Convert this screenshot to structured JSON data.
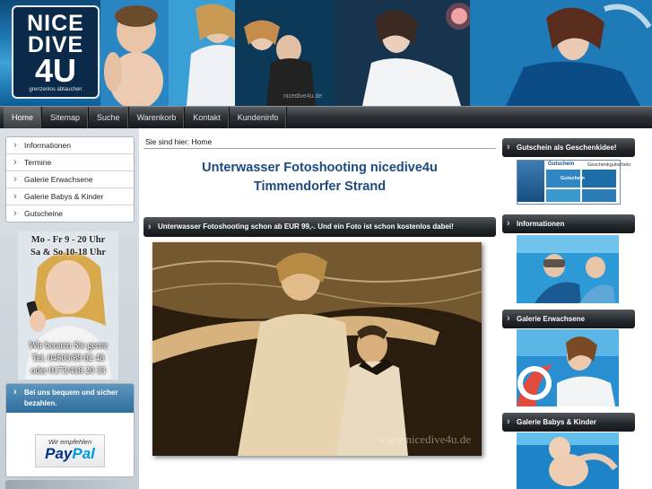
{
  "header": {
    "logo_line1": "NICE",
    "logo_line2": "DIVE",
    "logo_line3": "4U",
    "logo_tagline": "grenzenlos abtauchen",
    "watermark": "nicedive4u.de"
  },
  "nav": {
    "items": [
      "Home",
      "Sitemap",
      "Suche",
      "Warenkorb",
      "Kontakt",
      "Kundeninfo"
    ]
  },
  "left_menu": {
    "items": [
      "Informationen",
      "Termine",
      "Galerie Erwachsene",
      "Galerie Babys & Kinder",
      "Gutscheine"
    ]
  },
  "contact": {
    "hours1": "Mo - Fr 9 - 20 Uhr",
    "hours2": "Sa & So 10-18 Uhr",
    "advise": "Wir beraten Sie gerne",
    "phone1": "Tel. 04503/89 82 48",
    "phone2": "oder 0173/418 20 33"
  },
  "payment": {
    "heading": "Bei uns bequem und sicher bezahlen.",
    "recommend": "Wir empfehlen",
    "paypal_a": "Pay",
    "paypal_b": "Pal"
  },
  "main": {
    "breadcrumb": "Sie sind hier: Home",
    "title_line1": "Unterwasser Fotoshooting nicedive4u",
    "title_line2": "Timmendorfer Strand",
    "promo": "Unterwasser Fotoshooting schon ab EUR 99,-. Und ein Foto ist schon kostenlos dabei!",
    "photo_watermark": "www.nicedive4u.de"
  },
  "right": {
    "voucher_head": "Gutschein als Geschenkidee!",
    "voucher_title": "Gutschein",
    "voucher_tag": "Geschenkgutschein",
    "voucher_label": "Gutschein",
    "info_head": "Informationen",
    "adults_head": "Galerie Erwachsene",
    "kids_head": "Galerie Babys & Kinder"
  },
  "colors": {
    "accent_blue": "#1c4b82",
    "nav_dark": "#23272b",
    "sidebar_bg": "#d4dce3"
  }
}
